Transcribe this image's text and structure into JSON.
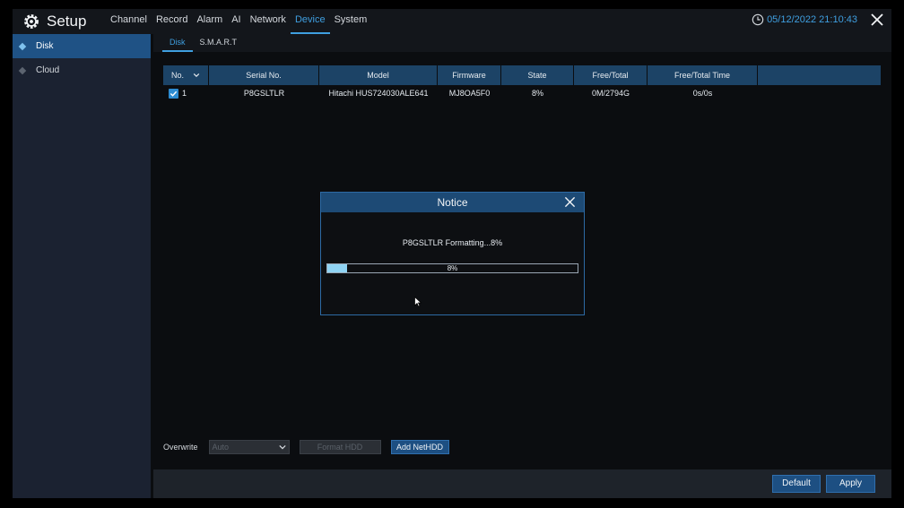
{
  "app": {
    "title": "Setup"
  },
  "topnav": [
    {
      "label": "Channel",
      "active": false
    },
    {
      "label": "Record",
      "active": false
    },
    {
      "label": "Alarm",
      "active": false
    },
    {
      "label": "AI",
      "active": false
    },
    {
      "label": "Network",
      "active": false
    },
    {
      "label": "Device",
      "active": true
    },
    {
      "label": "System",
      "active": false
    }
  ],
  "datetime": "05/12/2022 21:10:43",
  "sidebar": {
    "items": [
      {
        "label": "Disk",
        "active": true
      },
      {
        "label": "Cloud",
        "active": false
      }
    ]
  },
  "subtabs": [
    {
      "label": "Disk",
      "active": true
    },
    {
      "label": "S.M.A.R.T",
      "active": false
    }
  ],
  "table": {
    "headers": {
      "no": "No.",
      "serial": "Serial No.",
      "model": "Model",
      "firmware": "Firmware",
      "state": "State",
      "free_total": "Free/Total",
      "free_total_time": "Free/Total Time"
    },
    "rows": [
      {
        "checked": true,
        "no": "1",
        "serial": "P8GSLTLR",
        "model": "Hitachi HUS724030ALE641",
        "firmware": "MJ8OA5F0",
        "state": "8%",
        "free_total": "0M/2794G",
        "free_total_time": "0s/0s"
      }
    ]
  },
  "controls": {
    "overwrite_label": "Overwrite",
    "overwrite_value": "Auto",
    "format_label": "Format HDD",
    "add_nethdd_label": "Add NetHDD"
  },
  "footer": {
    "default_label": "Default",
    "apply_label": "Apply"
  },
  "modal": {
    "title": "Notice",
    "message": "P8GSLTLR Formatting...8%",
    "progress_text": "8%",
    "progress_value": 0.08
  },
  "colors": {
    "accent": "#3f9fe0",
    "header_blue": "#1c4366",
    "progress_fill": "#8fd3f3"
  },
  "icons": {
    "logo": "gear-icon",
    "clock": "clock-icon",
    "close": "close-icon",
    "sort": "chevron-down-icon",
    "check": "checkmark-icon"
  }
}
